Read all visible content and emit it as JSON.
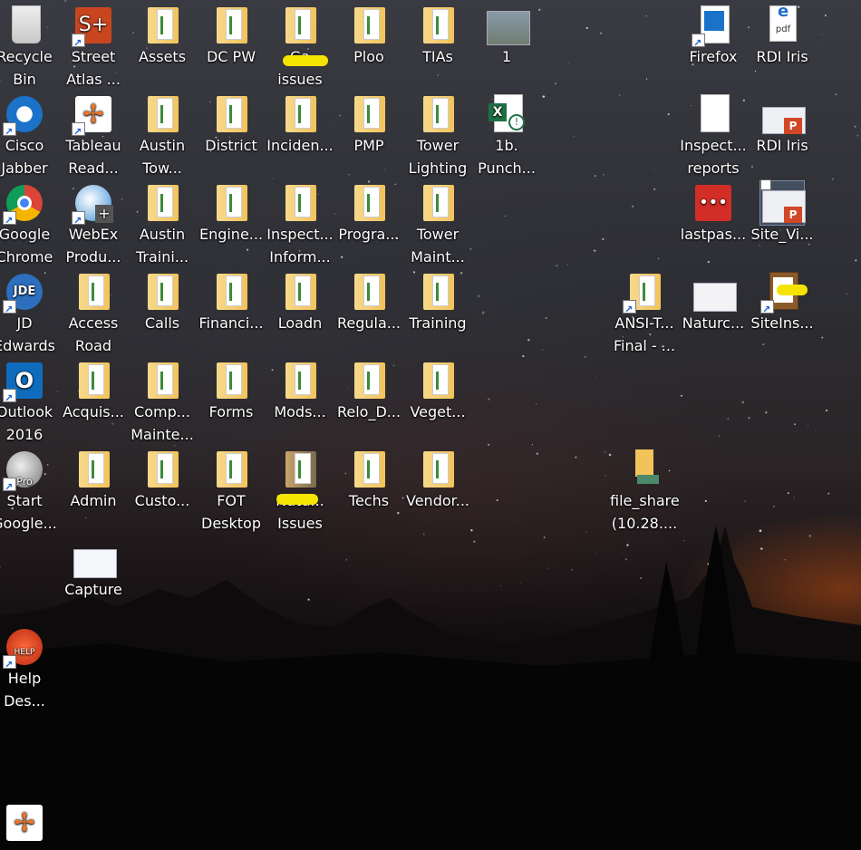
{
  "desktop": {
    "icons": [
      {
        "label": "Recycle\nBin"
      },
      {
        "label": "Street\nAtlas ..."
      },
      {
        "label": "Assets"
      },
      {
        "label": "DC PW"
      },
      {
        "label": "Ga\nissues"
      },
      {
        "label": "Ploo"
      },
      {
        "label": "TIAs"
      },
      {
        "label": "1"
      },
      {
        "label": "Firefox"
      },
      {
        "label": "RDI Iris"
      },
      {
        "label": "Cisco\nJabber"
      },
      {
        "label": "Tableau\nRead..."
      },
      {
        "label": "Austin\nTow..."
      },
      {
        "label": "District"
      },
      {
        "label": "Inciden..."
      },
      {
        "label": "PMP"
      },
      {
        "label": "Tower\nLighting"
      },
      {
        "label": "1b.\nPunch..."
      },
      {
        "label": "Inspect...\nreports"
      },
      {
        "label": "RDI Iris"
      },
      {
        "label": "Google\nChrome"
      },
      {
        "label": "WebEx\nProdu..."
      },
      {
        "label": "Austin\nTraini..."
      },
      {
        "label": "Engine..."
      },
      {
        "label": "Inspect...\nInform..."
      },
      {
        "label": "Progra..."
      },
      {
        "label": "Tower\nMaint..."
      },
      {
        "label": "lastpas..."
      },
      {
        "label": "Site_Vi..."
      },
      {
        "label": "JD\nEdwards"
      },
      {
        "label": "Access\nRoad"
      },
      {
        "label": "Calls"
      },
      {
        "label": "Financi..."
      },
      {
        "label": "Loadn"
      },
      {
        "label": "Regula..."
      },
      {
        "label": "Training"
      },
      {
        "label": "ANSI-T...\nFinal - ..."
      },
      {
        "label": "Naturc..."
      },
      {
        "label": "SiteIns..."
      },
      {
        "label": "Outlook\n2016"
      },
      {
        "label": "Acquis..."
      },
      {
        "label": "Comp...\nMainte..."
      },
      {
        "label": "Forms"
      },
      {
        "label": "Mods..."
      },
      {
        "label": "Relo_D..."
      },
      {
        "label": "Veget..."
      },
      {
        "label": "Start\nGoogle..."
      },
      {
        "label": "Admin"
      },
      {
        "label": "Custo..."
      },
      {
        "label": "FOT\nDesktop"
      },
      {
        "label": "Natu...\nIssues"
      },
      {
        "label": "Techs"
      },
      {
        "label": "Vendor..."
      },
      {
        "label": "file_share\n(10.28...."
      },
      {
        "label": "Capture"
      },
      {
        "label": "Help\nDes..."
      }
    ],
    "icon_glyphs": {
      "pdf_text": "pdf",
      "ppt_text": "P",
      "jde_text": "JDE",
      "outlook_text": "O",
      "pro_text": "Pro",
      "help_text": "HELP",
      "lastpass_text": "•••",
      "street_atlas_text": "S+",
      "tableau_text": "✢"
    },
    "colors": {
      "sky_top": "#3a3b42",
      "horizon_glow": "#c4541c",
      "ground": "#070606",
      "label_text": "#ffffff",
      "redaction": "#f5e400"
    }
  }
}
